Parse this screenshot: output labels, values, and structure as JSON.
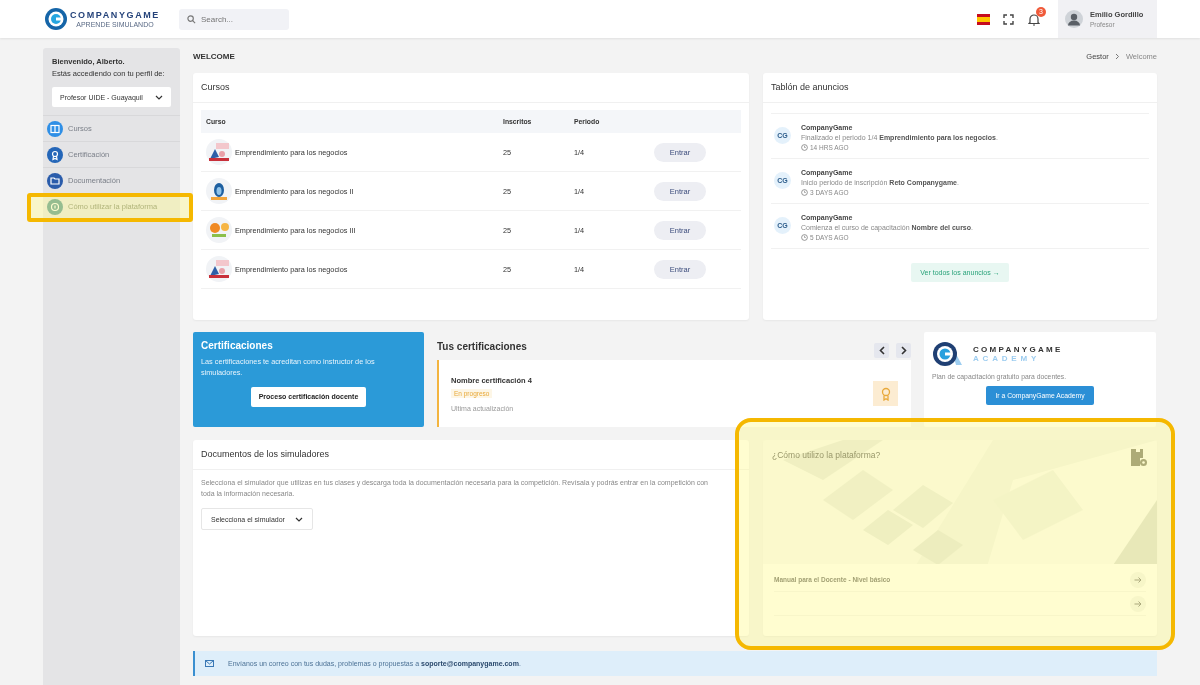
{
  "header": {
    "logo_name": "COMPANYGAME",
    "logo_tagline": "APRENDE SIMULANDO",
    "search": {
      "placeholder": "Search..."
    },
    "notifications_count": "3",
    "user": {
      "name": "Emilio Gordillo",
      "role": "Profesor"
    }
  },
  "sidebar": {
    "greeting": "Bienvenido, Alberto.",
    "profile_prompt": "Estás accediendo con tu perfil de:",
    "profile_select": "Profesor UIDE - Guayaquil",
    "items": [
      {
        "label": "Cursos",
        "kind": "book",
        "highlighted": false
      },
      {
        "label": "Certificación",
        "kind": "award",
        "highlighted": false
      },
      {
        "label": "Documentación",
        "kind": "folder",
        "highlighted": false
      },
      {
        "label": "Cómo utilizar la plataforma",
        "kind": "compass",
        "highlighted": true
      }
    ]
  },
  "page_title": "WELCOME",
  "breadcrumb": [
    "Gestor",
    "Welcome"
  ],
  "courses": {
    "title": "Cursos",
    "columns": [
      "Curso",
      "Inscritos",
      "Periodo"
    ],
    "rows": [
      {
        "name": "Emprendimiento para los negocios",
        "enrolled": "25",
        "period": "1/4",
        "action": "Entrar"
      },
      {
        "name": "Emprendimiento para los negocios II",
        "enrolled": "25",
        "period": "1/4",
        "action": "Entrar"
      },
      {
        "name": "Emprendimiento para los negocios III",
        "enrolled": "25",
        "period": "1/4",
        "action": "Entrar"
      },
      {
        "name": "Emprendimiento para los negocios",
        "enrolled": "25",
        "period": "1/4",
        "action": "Entrar"
      }
    ]
  },
  "announcements": {
    "title": "Tablón de anuncios",
    "items": [
      {
        "avatar": "CG",
        "author": "CompanyGame",
        "text": "Finalizado el periodo 1/4 **Emprendimiento para los negocios**.",
        "time": "14 HRS AGO"
      },
      {
        "avatar": "CG",
        "author": "CompanyGame",
        "text": "Inicio periodo de inscripción **Reto Companygame**.",
        "time": "3 DAYS AGO"
      },
      {
        "avatar": "CG",
        "author": "CompanyGame",
        "text": "Comienza el curso de capacitación **Nombre del curso**.",
        "time": "5 DAYS AGO"
      }
    ],
    "view_all": "Ver todos los anuncios →"
  },
  "certifications_promo": {
    "title": "Certificaciones",
    "text": "Las certificaciones te acreditan como instructor de los simuladores.",
    "button": "Proceso certificación docente"
  },
  "my_certifications": {
    "title": "Tus certificaciones",
    "items": [
      {
        "name": "Nombre certificación 4",
        "status": "En progreso",
        "updated": "Ultima actualización"
      }
    ]
  },
  "academy": {
    "brand": "COMPANYGAME",
    "brand_sub": "ACADEMY",
    "text": "Plan de capacitación gratuito para docentes.",
    "button": "Ir a CompanyGame Academy"
  },
  "documents": {
    "title": "Documentos de los simuladores",
    "text": "Selecciona el simulador que utilizas en tus clases y descarga toda la documentación necesaria para la competición. Revísala y podrás entrar en la competición con toda la información necesaria.",
    "select": "Selecciona el simulador"
  },
  "howto": {
    "title": "¿Cómo utilizo la plataforma?",
    "highlighted": true,
    "links": [
      "Manual para el Docente - Nivel básico"
    ]
  },
  "support": {
    "text": "Envíanos un correo con tus dudas, problemas o propuestas a **soporte@companygame.com**."
  }
}
